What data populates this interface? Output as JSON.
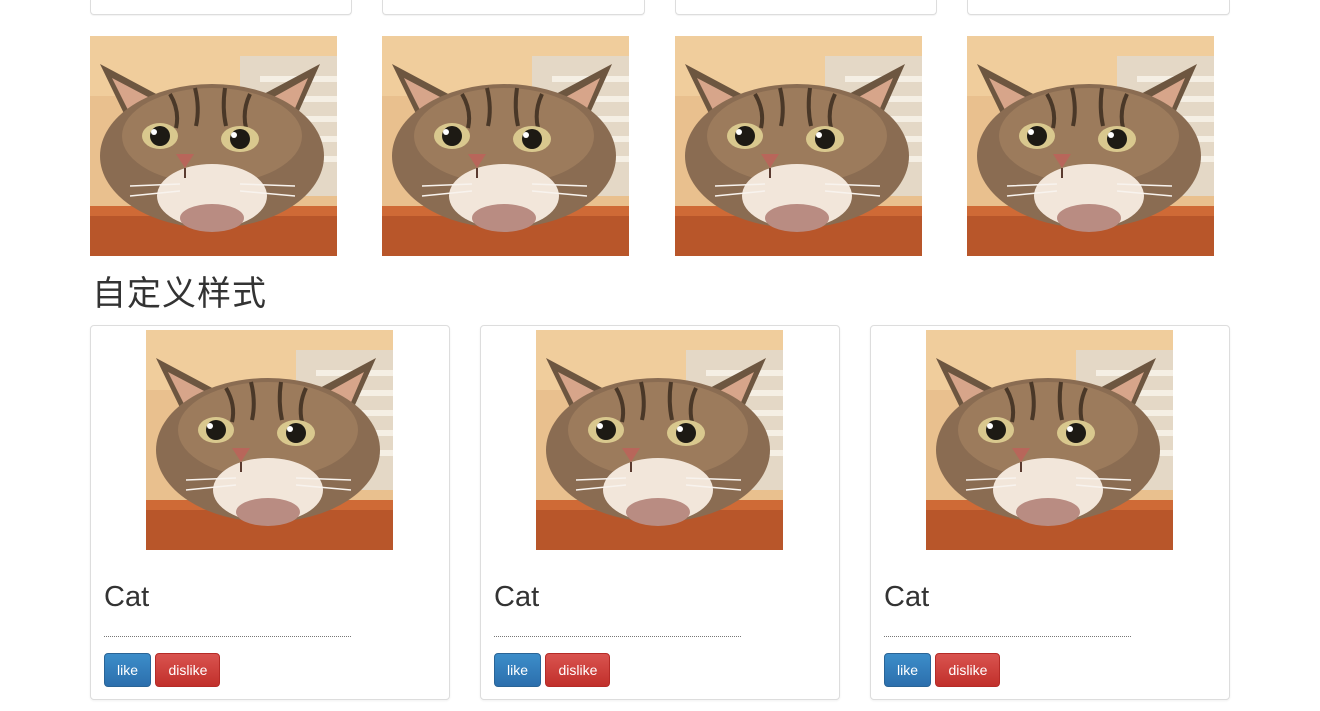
{
  "top_gallery": {
    "items": [
      {
        "image": "cat-photo"
      },
      {
        "image": "cat-photo"
      },
      {
        "image": "cat-photo"
      },
      {
        "image": "cat-photo"
      }
    ]
  },
  "section": {
    "title": "自定义样式"
  },
  "cards": [
    {
      "title": "Cat",
      "like_label": "like",
      "dislike_label": "dislike"
    },
    {
      "title": "Cat",
      "like_label": "like",
      "dislike_label": "dislike"
    },
    {
      "title": "Cat",
      "like_label": "like",
      "dislike_label": "dislike"
    }
  ],
  "colors": {
    "like": "#337ab7",
    "dislike": "#d9534f",
    "border": "#dddddd"
  }
}
